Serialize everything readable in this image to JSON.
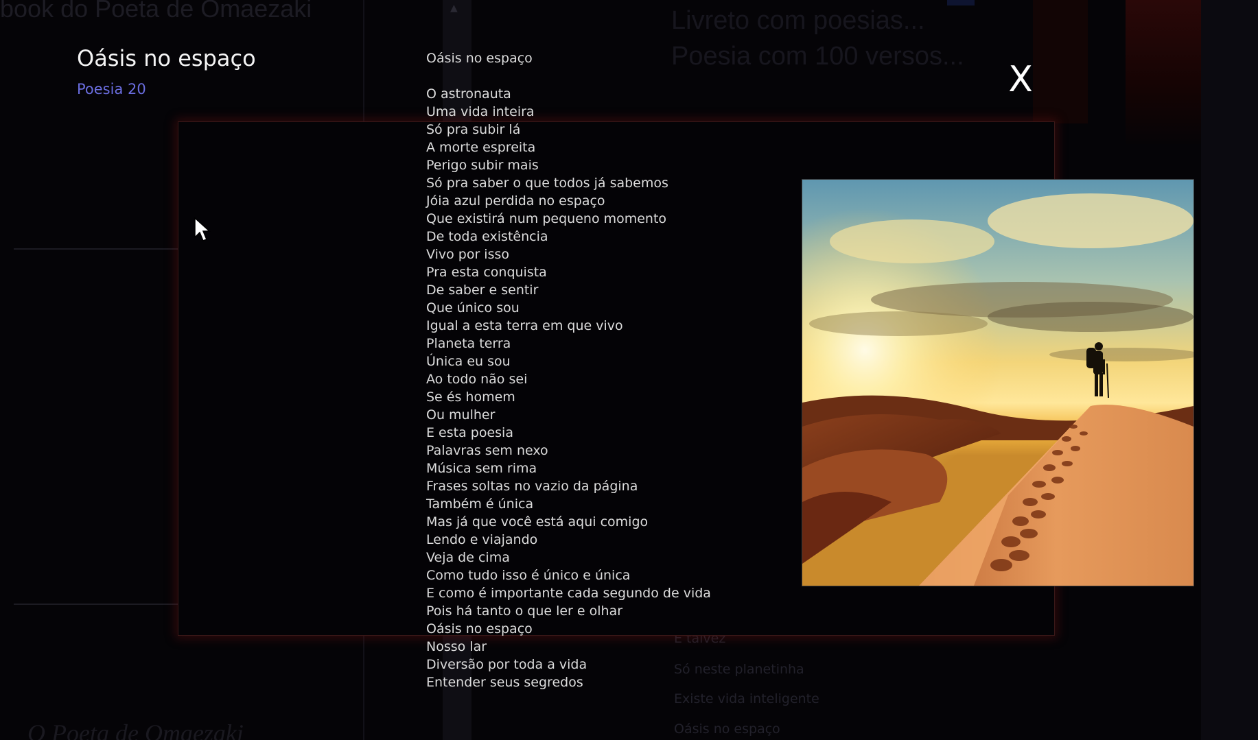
{
  "background": {
    "site_title": "book do Poeta de Omaezaki",
    "heading_lines": [
      "Livreto com poesias...",
      "Poesia com 100 versos..."
    ],
    "footer_links": [
      "E talvez",
      "Só neste planetinha",
      "Existe vida inteligente",
      "Oásis no espaço"
    ],
    "author": "O Poeta de Omaezaki"
  },
  "lightbox": {
    "title": "Oásis no espaço",
    "subtitle": "Poesia 20",
    "close_label": "X",
    "poem_heading": "Oásis no espaço",
    "poem_lines": [
      "O astronauta",
      "Uma vida inteira",
      "Só pra subir lá",
      "A morte espreita",
      "Perigo subir mais",
      "Só pra saber o que todos já sabemos",
      "Jóia azul perdida no espaço",
      "Que existirá num pequeno momento",
      "De toda existência",
      "Vivo por isso",
      "Pra esta conquista",
      "De saber e sentir",
      "Que único sou",
      "Igual a esta terra em que vivo",
      "Planeta terra",
      "Única eu sou",
      "Ao todo não sei",
      "Se és homem",
      "Ou mulher",
      "E esta poesia",
      "Palavras sem nexo",
      "Música sem rima",
      "Frases soltas no vazio da página",
      "Também é única",
      "Mas já que você está aqui comigo",
      "Lendo e viajando",
      "Veja de cima",
      "Como tudo isso é único e única",
      "E como é importante cada segundo de vida",
      "Pois há tanto o que ler e olhar",
      "Oásis no espaço",
      "Nosso lar",
      "Diversão por toda a vida",
      "Entender seus segredos"
    ],
    "image_icon": "desert-hiker-photo"
  },
  "colors": {
    "title": "#f4f4f4",
    "subtitle": "#6b6ee0",
    "poem_text": "#dcdcdc",
    "frame_border": "#3a1818"
  }
}
